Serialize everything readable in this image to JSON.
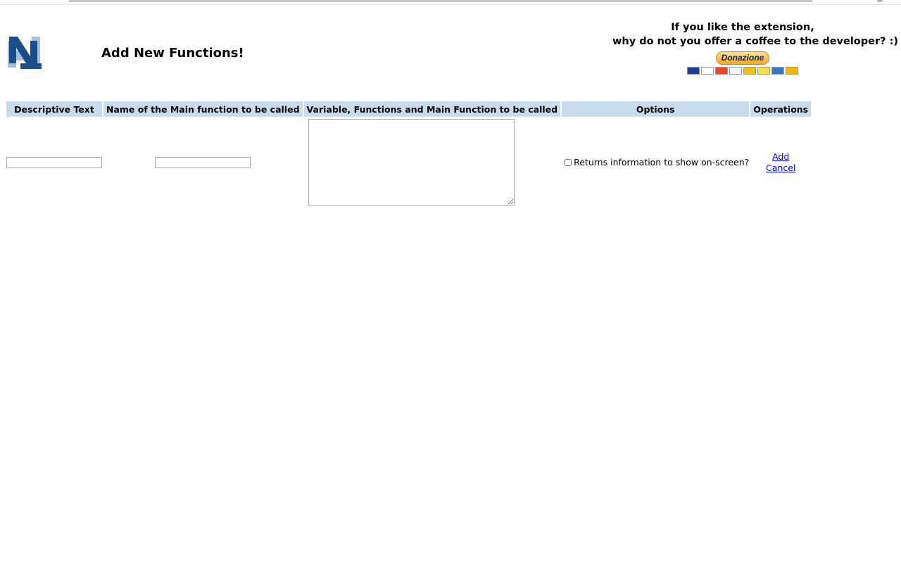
{
  "header": {
    "title": "Add New Functions!"
  },
  "donation": {
    "line1": "If you like the extension,",
    "line2": "why do not you offer a coffee to the developer? :)",
    "button_label": "Donazione",
    "cards": [
      "maestro-card-icon",
      "visa-card-icon",
      "mastercard-card-icon",
      "paypal-card-icon",
      "amex-card-icon",
      "discover-card-icon",
      "amex-blue-card-icon",
      "postepay-card-icon"
    ]
  },
  "table": {
    "headers": [
      "Descriptive Text",
      "Name of the Main function to be called",
      "Variable, Functions and Main Function to be called",
      "Options",
      "Operations"
    ],
    "row": {
      "descriptive_text": "",
      "main_function_name": "",
      "code": "",
      "option_label": "Returns information to show on-screen?",
      "option_checked": false,
      "ops": [
        "Add",
        "Cancel"
      ]
    }
  },
  "colors": {
    "header_bg": "#c9dcee",
    "logo_dark": "#1a4e8a",
    "logo_light": "#a9bfd6",
    "link": "#0000ee"
  }
}
